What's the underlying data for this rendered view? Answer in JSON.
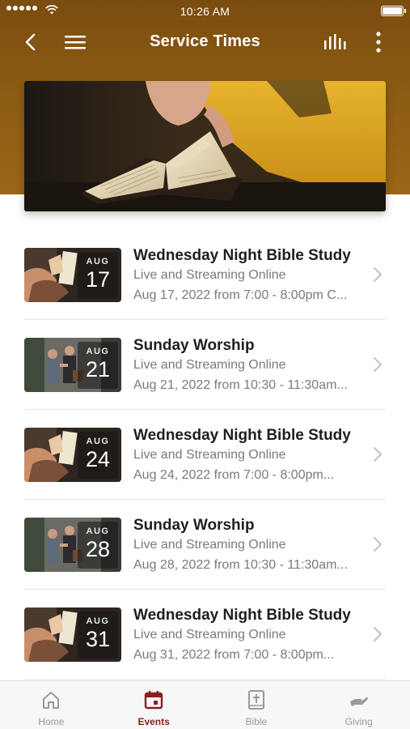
{
  "status_bar": {
    "time": "10:26 AM"
  },
  "navbar": {
    "title": "Service Times",
    "back_icon": "chevron-left-icon",
    "menu_icon": "hamburger-menu-icon",
    "bars_icon": "audio-bars-icon",
    "more_icon": "vertical-ellipsis-icon"
  },
  "colors": {
    "header": "#8b5a14",
    "active_tab": "#8a1f1f",
    "inactive_tab": "#9a9a9a"
  },
  "events": [
    {
      "month": "AUG",
      "day": "17",
      "title": "Wednesday Night Bible Study",
      "subtitle": "Live and Streaming Online",
      "when": "Aug 17, 2022 from 7:00 - 8:00pm C...",
      "thumb": "bible"
    },
    {
      "month": "AUG",
      "day": "21",
      "title": "Sunday Worship",
      "subtitle": "Live and Streaming Online",
      "when": "Aug 21, 2022 from 10:30 - 11:30am...",
      "thumb": "worship"
    },
    {
      "month": "AUG",
      "day": "24",
      "title": "Wednesday Night Bible Study",
      "subtitle": "Live and Streaming Online",
      "when": "Aug 24, 2022 from 7:00 - 8:00pm...",
      "thumb": "bible"
    },
    {
      "month": "AUG",
      "day": "28",
      "title": "Sunday Worship",
      "subtitle": "Live and Streaming Online",
      "when": "Aug 28, 2022 from 10:30 - 11:30am...",
      "thumb": "worship"
    },
    {
      "month": "AUG",
      "day": "31",
      "title": "Wednesday Night Bible Study",
      "subtitle": "Live and Streaming Online",
      "when": "Aug 31, 2022 from 7:00 - 8:00pm...",
      "thumb": "bible"
    }
  ],
  "tabbar": {
    "items": [
      {
        "label": "Home",
        "icon": "home-icon",
        "active": false
      },
      {
        "label": "Events",
        "icon": "calendar-icon",
        "active": true
      },
      {
        "label": "Bible",
        "icon": "bible-icon",
        "active": false
      },
      {
        "label": "Giving",
        "icon": "giving-hand-icon",
        "active": false
      }
    ]
  }
}
